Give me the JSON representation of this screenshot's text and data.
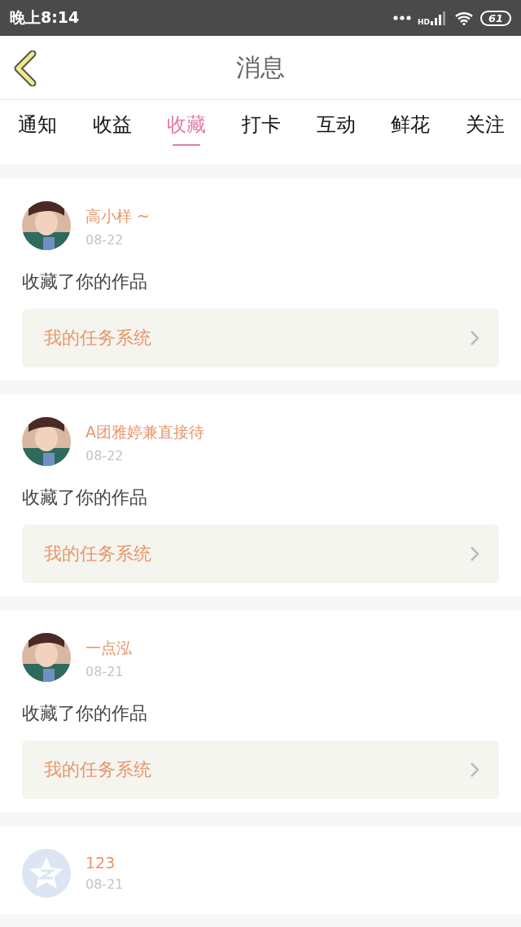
{
  "status_bar": {
    "time": "晚上8:14",
    "network": "HD",
    "battery": "61"
  },
  "header": {
    "title": "消息"
  },
  "tabs": [
    {
      "label": "通知",
      "selected": false
    },
    {
      "label": "收益",
      "selected": false
    },
    {
      "label": "收藏",
      "selected": true
    },
    {
      "label": "打卡",
      "selected": false
    },
    {
      "label": "互动",
      "selected": false
    },
    {
      "label": "鲜花",
      "selected": false
    },
    {
      "label": "关注",
      "selected": false
    }
  ],
  "messages": [
    {
      "name": "高小样 ~",
      "date": "08-22",
      "text": "收藏了你的作品",
      "link": "我的任务系统"
    },
    {
      "name": "A团雅婷兼直接待",
      "date": "08-22",
      "text": "收藏了你的作品",
      "link": "我的任务系统"
    },
    {
      "name": "一点泓",
      "date": "08-21",
      "text": "收藏了你的作品",
      "link": "我的任务系统"
    },
    {
      "avatar": {
        "kind": "default"
      },
      "name": "123",
      "date": "08-21"
    }
  ]
}
